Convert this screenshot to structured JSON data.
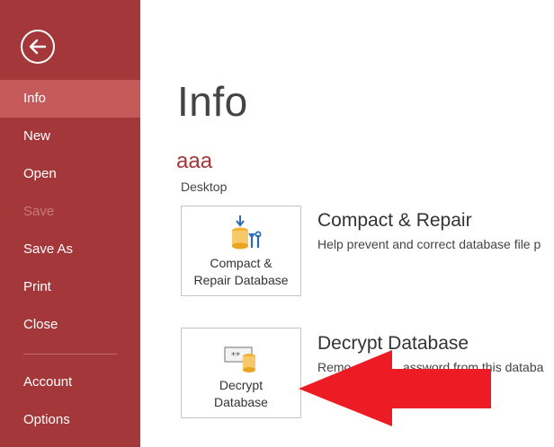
{
  "sidebar": {
    "items": [
      {
        "label": "Info",
        "state": "selected"
      },
      {
        "label": "New",
        "state": "normal"
      },
      {
        "label": "Open",
        "state": "normal"
      },
      {
        "label": "Save",
        "state": "disabled"
      },
      {
        "label": "Save As",
        "state": "normal"
      },
      {
        "label": "Print",
        "state": "normal"
      },
      {
        "label": "Close",
        "state": "normal"
      },
      {
        "label": "Account",
        "state": "normal"
      },
      {
        "label": "Options",
        "state": "normal"
      }
    ]
  },
  "main": {
    "title": "Info",
    "db_name": "aaa",
    "db_location": "Desktop",
    "compact": {
      "tile_line1": "Compact &",
      "tile_line2": "Repair Database",
      "title": "Compact & Repair",
      "description": "Help prevent and correct database file p"
    },
    "decrypt": {
      "tile_line1": "Decrypt",
      "tile_line2": "Database",
      "title": "Decrypt Database",
      "desc_start": "Remo",
      "desc_end": "assword from this databa"
    }
  },
  "colors": {
    "sidebar_bg": "#a4373a",
    "selected_bg": "#c55a5a",
    "accent_red": "#ed1c24"
  }
}
